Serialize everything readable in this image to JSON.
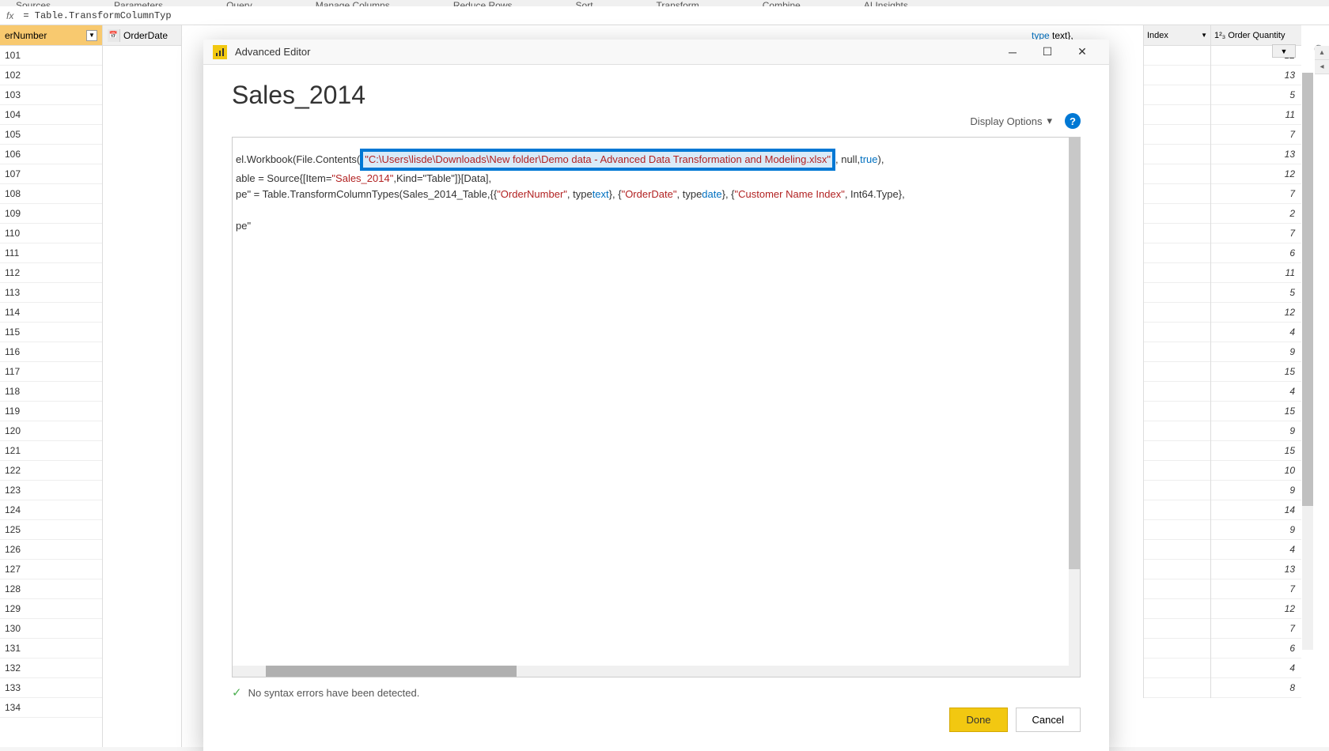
{
  "ribbon": {
    "items": [
      "Sources",
      "Parameters",
      "Query",
      "Manage Columns",
      "Reduce Rows",
      "Sort",
      "Transform",
      "Combine",
      "AI Insights"
    ]
  },
  "formulaBar": {
    "fx": "fx",
    "formula": "= Table.TransformColumnTyp"
  },
  "grid": {
    "orderNumberHeader": "erNumber",
    "orderDateHeader": "OrderDate",
    "indexHeader": "Index",
    "orderQtyHeader": "Order Quantity",
    "orderQtyPrefix": "1²₃",
    "orderNumbers": [
      "101",
      "102",
      "103",
      "104",
      "105",
      "106",
      "107",
      "108",
      "109",
      "110",
      "111",
      "112",
      "113",
      "114",
      "115",
      "116",
      "117",
      "118",
      "119",
      "120",
      "121",
      "122",
      "123",
      "124",
      "125",
      "126",
      "127",
      "128",
      "129",
      "130",
      "131",
      "132",
      "133",
      "134"
    ],
    "qtyValues": [
      "12",
      "13",
      "5",
      "11",
      "7",
      "13",
      "12",
      "7",
      "2",
      "7",
      "6",
      "11",
      "5",
      "12",
      "4",
      "9",
      "15",
      "4",
      "15",
      "9",
      "15",
      "10",
      "9",
      "14",
      "9",
      "4",
      "13",
      "7",
      "12",
      "7",
      "6",
      "4",
      "8"
    ],
    "formulaCellPrefix": "type",
    "formulaCellText": "text},"
  },
  "modal": {
    "title": "Advanced Editor",
    "queryName": "Sales_2014",
    "displayOptions": "Display Options",
    "help": "?",
    "code": {
      "line1_pre": "el.Workbook(File.Contents(",
      "line1_path": "\"C:\\Users\\lisde\\Downloads\\New folder\\Demo data - Advanced Data Transformation and Modeling.xlsx\"",
      "line1_post_null": ", null, ",
      "line1_post_true": "true",
      "line1_end": "),",
      "line2_pre": "able = Source{[Item=",
      "line2_str": "\"Sales_2014\"",
      "line2_mid": ",Kind=\"Table\"]}[Data],",
      "line3_pre": "pe\" = Table.TransformColumnTypes(Sales_2014_Table,{{",
      "line3_c1": "\"OrderNumber\"",
      "line3_t1": ", type ",
      "line3_kw1": "text",
      "line3_m1": "}, {",
      "line3_c2": "\"OrderDate\"",
      "line3_t2": ", type ",
      "line3_kw2": "date",
      "line3_m2": "}, {",
      "line3_c3": "\"Customer Name Index\"",
      "line3_end": ", Int64.Type},",
      "line4": "pe\""
    },
    "status": "No syntax errors have been detected.",
    "doneBtn": "Done",
    "cancelBtn": "Cancel"
  }
}
